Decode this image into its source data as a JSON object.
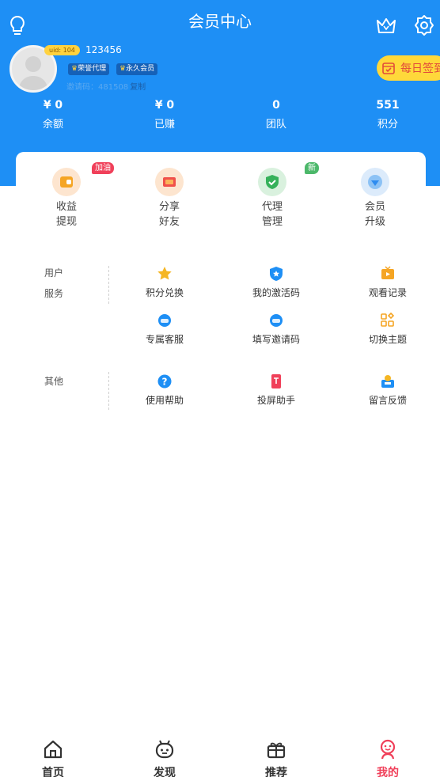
{
  "header": {
    "title": "会员中心",
    "icons": [
      "lightbulb-icon",
      "crown-icon",
      "gear-icon"
    ],
    "accent_color": "#1e8ff5"
  },
  "profile": {
    "uid_badge": "uid: 104",
    "username": "123456",
    "tags": [
      "荣誉代理",
      "永久会员"
    ],
    "invite_label": "邀请码：481508",
    "copy_label": "复制",
    "checkin_label": "每日签到"
  },
  "stats": [
    {
      "value": "¥ 0",
      "label": "余额"
    },
    {
      "value": "¥ 0",
      "label": "已赚"
    },
    {
      "value": "0",
      "label": "团队"
    },
    {
      "value": "551",
      "label": "积分"
    }
  ],
  "quick_actions": [
    {
      "line1": "收益",
      "line2": "提现",
      "badge": "加油",
      "icon": "wallet-icon"
    },
    {
      "line1": "分享",
      "line2": "好友",
      "badge": "",
      "icon": "share-ticket-icon"
    },
    {
      "line1": "代理",
      "line2": "管理",
      "badge": "新",
      "icon": "shield-check-icon"
    },
    {
      "line1": "会员",
      "line2": "升级",
      "badge": "",
      "icon": "diamond-icon"
    }
  ],
  "sections": {
    "user_service": {
      "label_line1": "用户",
      "label_line2": "服务",
      "items": [
        {
          "label": "积分兑换",
          "icon": "star-icon"
        },
        {
          "label": "我的激活码",
          "icon": "badge-star-icon"
        },
        {
          "label": "观看记录",
          "icon": "tv-icon"
        },
        {
          "label": "专属客服",
          "icon": "headset-icon"
        },
        {
          "label": "填写邀请码",
          "icon": "chat-bubble-icon"
        },
        {
          "label": "切换主题",
          "icon": "grid-theme-icon"
        }
      ]
    },
    "other": {
      "label": "其他",
      "items": [
        {
          "label": "使用帮助",
          "icon": "help-icon"
        },
        {
          "label": "投屏助手",
          "icon": "cast-icon"
        },
        {
          "label": "留言反馈",
          "icon": "mailbox-icon"
        }
      ]
    }
  },
  "bottom_nav": [
    {
      "label": "首页",
      "icon": "home-icon",
      "active": false
    },
    {
      "label": "发现",
      "icon": "robot-icon",
      "active": false
    },
    {
      "label": "推荐",
      "icon": "gift-icon",
      "active": false
    },
    {
      "label": "我的",
      "icon": "user-smile-icon",
      "active": true
    }
  ],
  "active_color": "#f0405a"
}
